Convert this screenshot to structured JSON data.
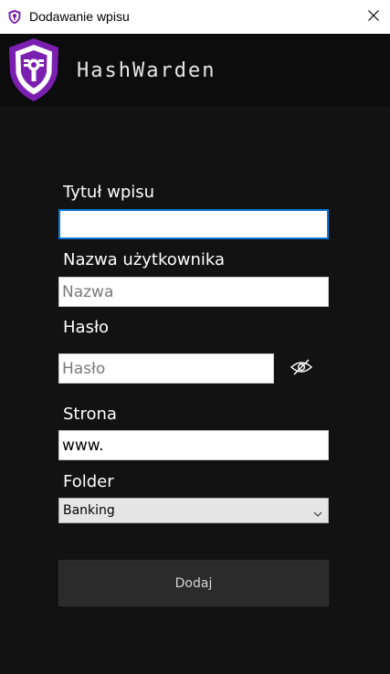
{
  "window": {
    "title": "Dodawanie wpisu",
    "app_icon": "hashwarden-shield-icon",
    "close_icon": "close-icon"
  },
  "header": {
    "brand": "HashWarden",
    "logo_icon": "shield-keyhole-logo",
    "accent_color": "#7a1fb0"
  },
  "form": {
    "title_label": "Tytuł wpisu",
    "title_value": "",
    "username_label": "Nazwa użytkownika",
    "username_placeholder": "Nazwa",
    "password_label": "Hasło",
    "password_placeholder": "Hasło",
    "password_toggle_icon": "eye-slash-icon",
    "site_label": "Strona",
    "site_value": "www.",
    "folder_label": "Folder",
    "folder_selected": "Banking",
    "submit_label": "Dodaj"
  }
}
